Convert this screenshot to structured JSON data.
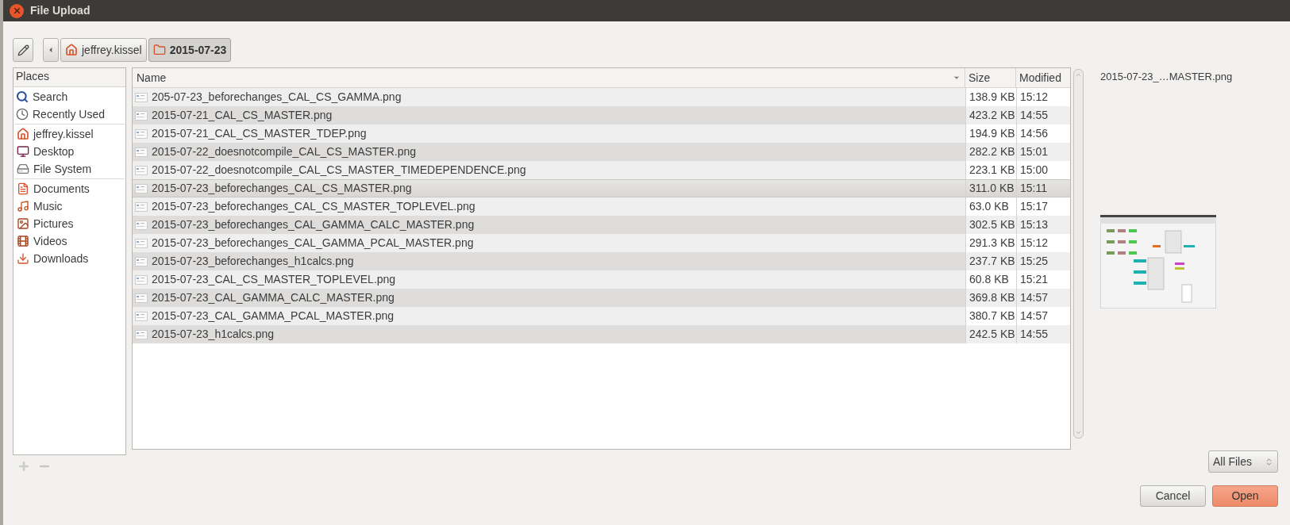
{
  "window": {
    "title": "File Upload"
  },
  "path_bar": [
    {
      "label": "jeffrey.kissel",
      "kind": "home",
      "selected": false
    },
    {
      "label": "2015-07-23",
      "kind": "folder",
      "selected": true
    }
  ],
  "places": {
    "header": "Places",
    "sections": [
      [
        {
          "label": "Search",
          "kind": "search"
        },
        {
          "label": "Recently Used",
          "kind": "recent"
        }
      ],
      [
        {
          "label": "jeffrey.kissel",
          "kind": "home"
        },
        {
          "label": "Desktop",
          "kind": "desktop"
        },
        {
          "label": "File System",
          "kind": "drive"
        }
      ],
      [
        {
          "label": "Documents",
          "kind": "documents"
        },
        {
          "label": "Music",
          "kind": "music"
        },
        {
          "label": "Pictures",
          "kind": "pictures"
        },
        {
          "label": "Videos",
          "kind": "videos"
        },
        {
          "label": "Downloads",
          "kind": "downloads"
        }
      ]
    ]
  },
  "files": {
    "columns": [
      "Name",
      "Size",
      "Modified"
    ],
    "rows": [
      {
        "name": "205-07-23_beforechanges_CAL_CS_GAMMA.png",
        "size": "138.9 KB",
        "modified": "15:12",
        "selected": false
      },
      {
        "name": "2015-07-21_CAL_CS_MASTER.png",
        "size": "423.2 KB",
        "modified": "14:55",
        "selected": false
      },
      {
        "name": "2015-07-21_CAL_CS_MASTER_TDEP.png",
        "size": "194.9 KB",
        "modified": "14:56",
        "selected": false
      },
      {
        "name": "2015-07-22_doesnotcompile_CAL_CS_MASTER.png",
        "size": "282.2 KB",
        "modified": "15:01",
        "selected": false
      },
      {
        "name": "2015-07-22_doesnotcompile_CAL_CS_MASTER_TIMEDEPENDENCE.png",
        "size": "223.1 KB",
        "modified": "15:00",
        "selected": false
      },
      {
        "name": "2015-07-23_beforechanges_CAL_CS_MASTER.png",
        "size": "311.0 KB",
        "modified": "15:11",
        "selected": true
      },
      {
        "name": "2015-07-23_beforechanges_CAL_CS_MASTER_TOPLEVEL.png",
        "size": "63.0 KB",
        "modified": "15:17",
        "selected": false
      },
      {
        "name": "2015-07-23_beforechanges_CAL_GAMMA_CALC_MASTER.png",
        "size": "302.5 KB",
        "modified": "15:13",
        "selected": false
      },
      {
        "name": "2015-07-23_beforechanges_CAL_GAMMA_PCAL_MASTER.png",
        "size": "291.3 KB",
        "modified": "15:12",
        "selected": false
      },
      {
        "name": "2015-07-23_beforechanges_h1calcs.png",
        "size": "237.7 KB",
        "modified": "15:25",
        "selected": false
      },
      {
        "name": "2015-07-23_CAL_CS_MASTER_TOPLEVEL.png",
        "size": "60.8 KB",
        "modified": "15:21",
        "selected": false
      },
      {
        "name": "2015-07-23_CAL_GAMMA_CALC_MASTER.png",
        "size": "369.8 KB",
        "modified": "14:57",
        "selected": false
      },
      {
        "name": "2015-07-23_CAL_GAMMA_PCAL_MASTER.png",
        "size": "380.7 KB",
        "modified": "14:57",
        "selected": false
      },
      {
        "name": "2015-07-23_h1calcs.png",
        "size": "242.5 KB",
        "modified": "14:55",
        "selected": false
      }
    ]
  },
  "preview": {
    "filename": "2015-07-23_…MASTER.png",
    "kind": "picture"
  },
  "filter": {
    "value": "All Files"
  },
  "buttons": [
    {
      "label": "Cancel",
      "kind": "secondary"
    },
    {
      "label": "Open",
      "kind": "primary"
    }
  ]
}
